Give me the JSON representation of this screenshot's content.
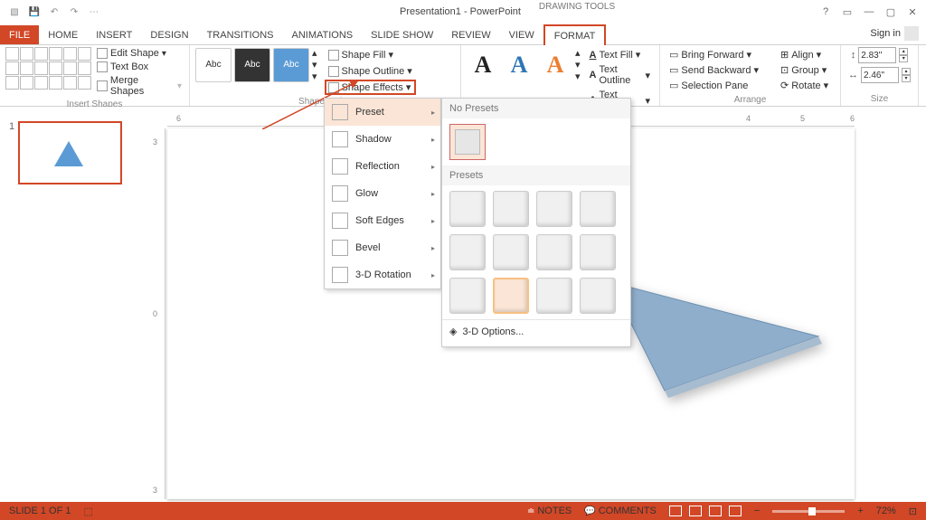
{
  "title": "Presentation1 - PowerPoint",
  "context_tab": "DRAWING TOOLS",
  "signin": "Sign in",
  "tabs": {
    "file": "FILE",
    "home": "HOME",
    "insert": "INSERT",
    "design": "DESIGN",
    "transitions": "TRANSITIONS",
    "animations": "ANIMATIONS",
    "slideshow": "SLIDE SHOW",
    "review": "REVIEW",
    "view": "VIEW",
    "format": "FORMAT"
  },
  "ribbon": {
    "insert_shapes": {
      "edit_shape": "Edit Shape",
      "text_box": "Text Box",
      "merge": "Merge Shapes",
      "label": "Insert Shapes"
    },
    "shape_styles": {
      "abc": "Abc",
      "fill": "Shape Fill",
      "outline": "Shape Outline",
      "effects": "Shape Effects",
      "label": "Shape Styles"
    },
    "wordart": {
      "fill": "Text Fill",
      "outline": "Text Outline",
      "effects": "Text Effects"
    },
    "arrange": {
      "forward": "Bring Forward",
      "backward": "Send Backward",
      "selectionPane": "Selection Pane",
      "align": "Align",
      "group": "Group",
      "rotate": "Rotate",
      "label": "Arrange"
    },
    "size": {
      "height": "2.83\"",
      "width": "2.46\"",
      "label": "Size"
    }
  },
  "effects_menu": {
    "preset": "Preset",
    "shadow": "Shadow",
    "reflection": "Reflection",
    "glow": "Glow",
    "softedges": "Soft Edges",
    "bevel": "Bevel",
    "rotation3d": "3-D Rotation"
  },
  "preset_popup": {
    "no_presets": "No Presets",
    "presets": "Presets",
    "options3d": "3-D Options..."
  },
  "status": {
    "slide": "SLIDE 1 OF 1",
    "notes": "NOTES",
    "comments": "COMMENTS",
    "zoom": "72%"
  },
  "thumb_num": "1"
}
